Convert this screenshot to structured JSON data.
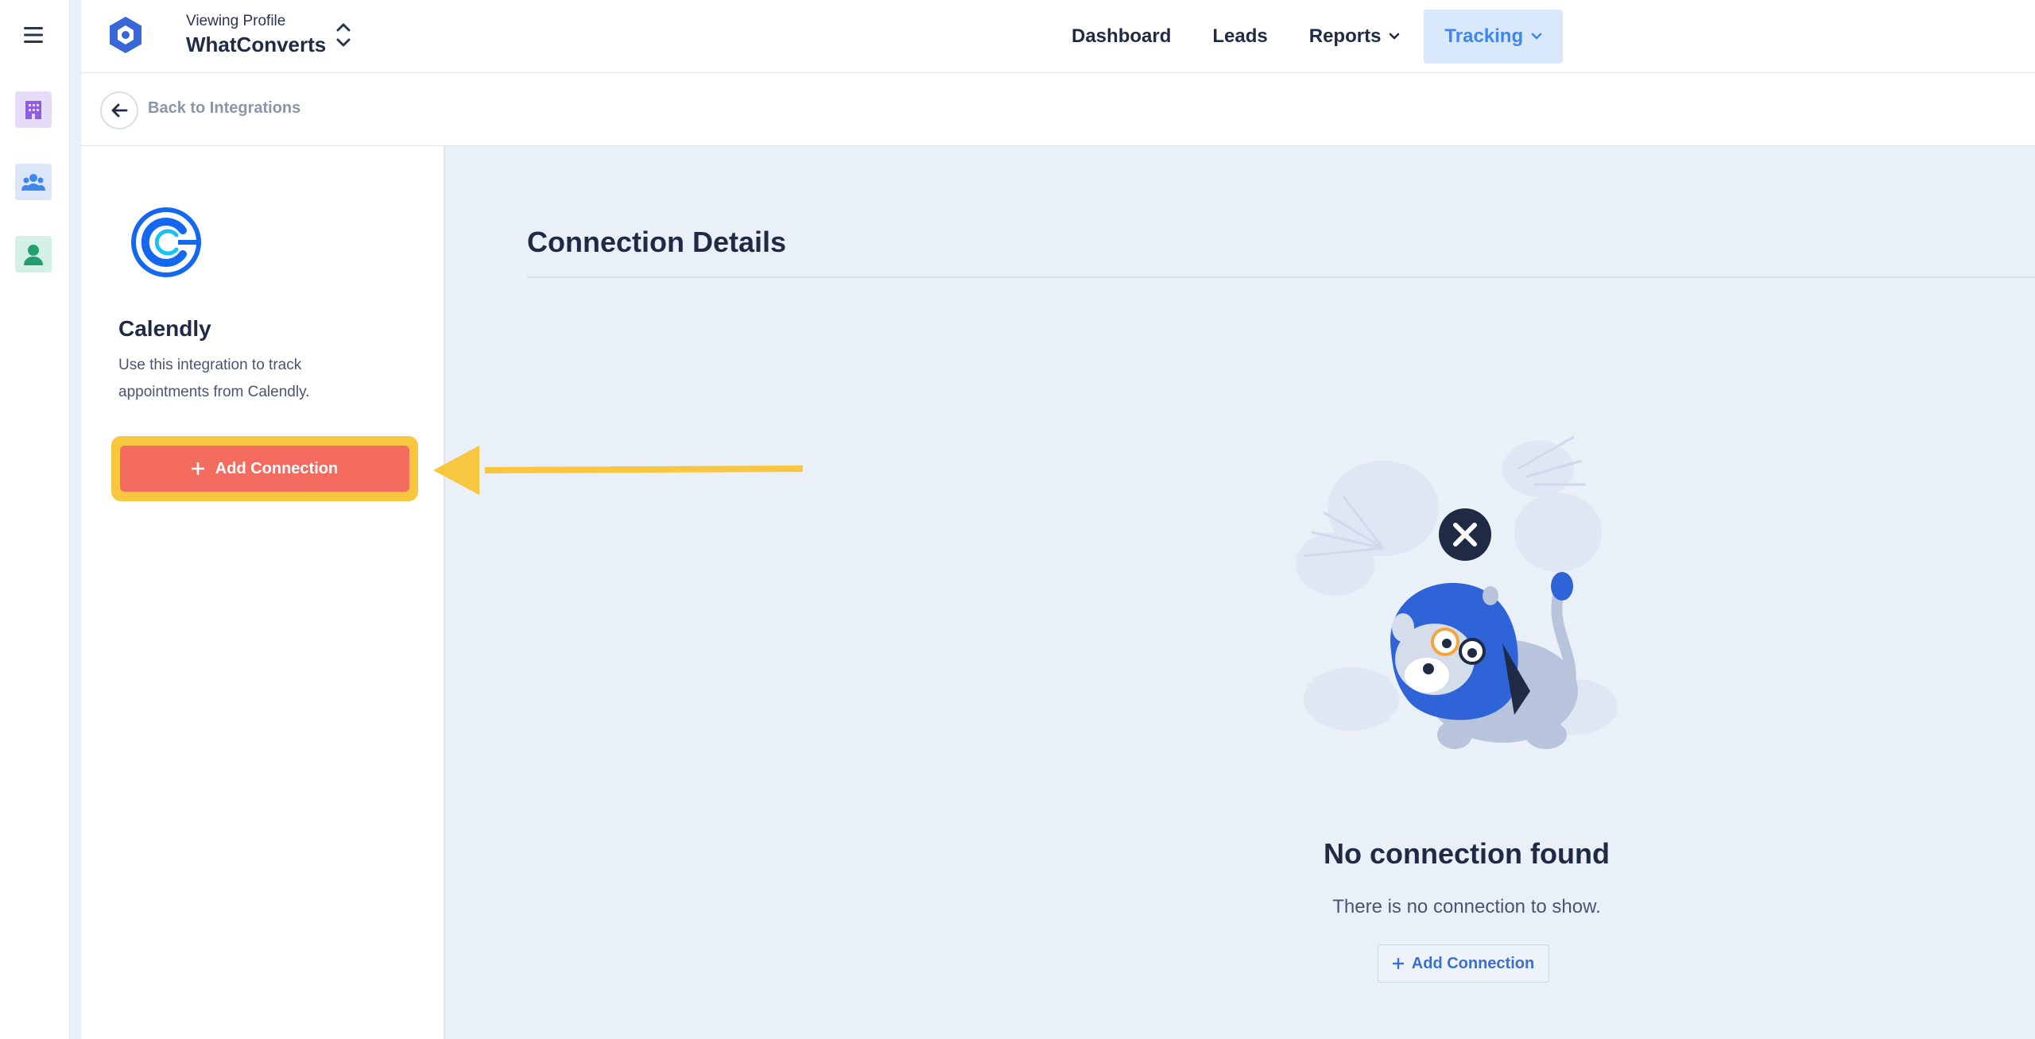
{
  "topbar": {
    "profile_label": "Viewing Profile",
    "profile_name": "WhatConverts",
    "nav": [
      {
        "label": "Dashboard"
      },
      {
        "label": "Leads"
      },
      {
        "label": "Reports"
      },
      {
        "label": "Tracking"
      }
    ]
  },
  "subbar": {
    "back_label": "Back to Integrations"
  },
  "integration": {
    "title": "Calendly",
    "description": "Use this integration to track appointments from Calendly.",
    "add_button": "Add Connection"
  },
  "main": {
    "title": "Connection Details",
    "empty_title": "No connection found",
    "empty_subtitle": "There is no connection to show.",
    "empty_button": "Add Connection"
  },
  "colors": {
    "accent": "#3f86ee",
    "add_button": "#f46b5f",
    "highlight": "#f9c63f",
    "background": "#eaf0f8"
  },
  "icons": [
    "hamburger-menu-icon",
    "building-icon",
    "users-icon",
    "user-icon",
    "whatconverts-logo-icon",
    "chevron-updown-icon",
    "chevron-down-icon",
    "arrow-left-icon",
    "calendly-logo-icon",
    "plus-icon",
    "close-icon"
  ]
}
